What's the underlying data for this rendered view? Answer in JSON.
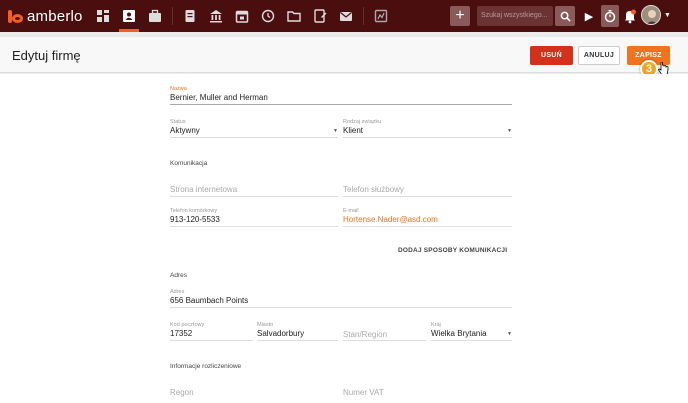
{
  "app": {
    "logo_text": "amberlo"
  },
  "topbar": {
    "nav_icons": [
      "dashboard-icon",
      "contacts-icon",
      "matters-icon",
      "documents-icon",
      "institution-icon",
      "calendar-icon",
      "history-icon",
      "folder-icon",
      "notes-icon",
      "mail-icon",
      "reports-icon"
    ],
    "add_label": "+",
    "search_placeholder": "Szukaj wszystkiego...",
    "play_label": "▶",
    "avatar_caret": "▼",
    "colors": {
      "bar": "#4a0e0e",
      "accent": "#f25f22"
    }
  },
  "header": {
    "title": "Edytuj firmę",
    "delete_label": "USUŃ",
    "cancel_label": "ANULUJ",
    "save_label": "ZAPISZ",
    "step_badge": "3"
  },
  "form": {
    "name": {
      "label": "Nazwa",
      "value": "Bernier, Muller and Herman"
    },
    "status": {
      "label": "Status",
      "value": "Aktywny"
    },
    "relation": {
      "label": "Rodzaj związku",
      "value": "Klient"
    },
    "communication_title": "Komunikacja",
    "website": {
      "placeholder": "Strona internetowa"
    },
    "work_phone": {
      "placeholder": "Telefon służbowy"
    },
    "mobile": {
      "label": "Telefon komórkowy",
      "value": "913-120-5533"
    },
    "email": {
      "label": "E-mail",
      "value": "Hortense.Nader@asd.com"
    },
    "add_communication_label": "DODAJ SPOSOBY KOMUNIKACJI",
    "address_title": "Adres",
    "address": {
      "label": "Adres",
      "value": "656 Baumbach Points"
    },
    "postal": {
      "label": "Kod pocztowy",
      "value": "17352"
    },
    "city": {
      "label": "Miasto",
      "value": "Salvadorbury"
    },
    "state": {
      "placeholder": "Stan/Region"
    },
    "country": {
      "label": "Kraj",
      "value": "Wielka Brytania"
    },
    "billing_title": "Informacje rozliczeniowe",
    "regon": {
      "placeholder": "Regon"
    },
    "vat": {
      "placeholder": "Numer VAT"
    }
  }
}
